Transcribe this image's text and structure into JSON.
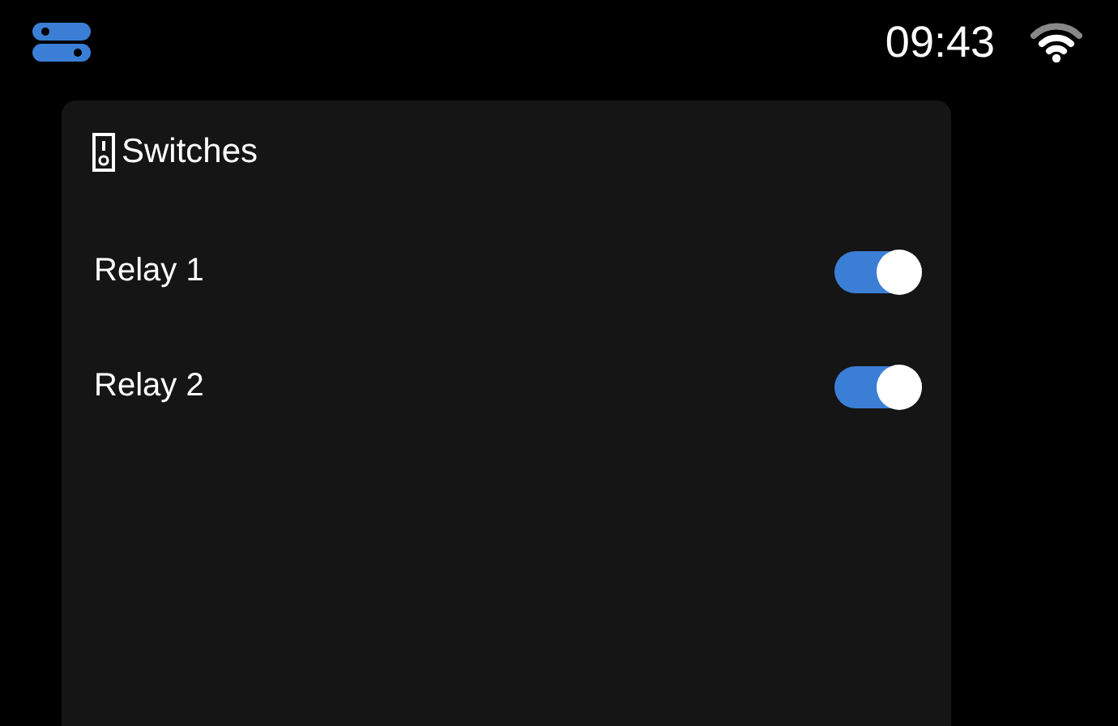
{
  "status_bar": {
    "time": "09:43"
  },
  "card": {
    "title": "Switches",
    "switches": [
      {
        "label": "Relay 1",
        "on": true
      },
      {
        "label": "Relay 2",
        "on": true
      }
    ]
  }
}
